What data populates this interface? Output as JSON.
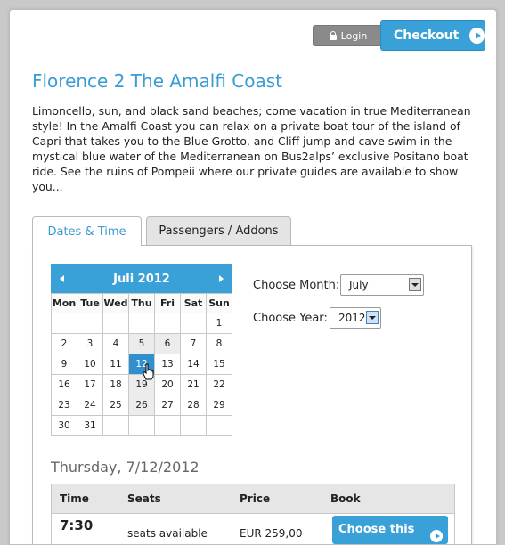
{
  "header": {
    "login_label": "Login",
    "checkout_label": "Checkout"
  },
  "tour": {
    "title": "Florence 2 The Amalfi Coast",
    "description": "Limoncello, sun, and black sand beaches; come vacation in true Mediterranean style! In the Amalfi Coast you can relax on a private boat tour of the island of Capri that takes you to the Blue Grotto, and Cliff jump and cave swim in the mystical blue water of the Mediterranean on Bus2alps’ exclusive Positano boat ride. See the ruins of Pompeii where our private guides are available to show you..."
  },
  "tabs": [
    {
      "label": "Dates & Time",
      "active": true
    },
    {
      "label": "Passengers / Addons",
      "active": false
    }
  ],
  "calendar": {
    "month_title": "Juli 2012",
    "weekdays": [
      "Mon",
      "Tue",
      "Wed",
      "Thu",
      "Fri",
      "Sat",
      "Sun"
    ],
    "weeks": [
      [
        "",
        "",
        "",
        "",
        "",
        "",
        "1"
      ],
      [
        "2",
        "3",
        "4",
        "5",
        "6",
        "7",
        "8"
      ],
      [
        "9",
        "10",
        "11",
        "12",
        "13",
        "14",
        "15"
      ],
      [
        "16",
        "17",
        "18",
        "19",
        "20",
        "21",
        "22"
      ],
      [
        "23",
        "24",
        "25",
        "26",
        "27",
        "28",
        "29"
      ],
      [
        "30",
        "31",
        "",
        "",
        "",
        "",
        ""
      ]
    ],
    "available_days": [
      "5",
      "6",
      "12",
      "19",
      "26"
    ],
    "selected_day": "12"
  },
  "selectors": {
    "month_label": "Choose Month:",
    "month_value": "July",
    "year_label": "Choose Year:",
    "year_value": "2012"
  },
  "schedule": {
    "date_title": "Thursday, 7/12/2012",
    "columns": [
      "Time",
      "Seats",
      "Price",
      "Book"
    ],
    "rows": [
      {
        "time": "7:30",
        "seats": "seats available",
        "price": "EUR 259,00",
        "book_label": "Choose this"
      }
    ]
  },
  "colors": {
    "accent": "#3aa0d8",
    "title": "#3a9bd5",
    "login_bg": "#8a8a8a"
  }
}
